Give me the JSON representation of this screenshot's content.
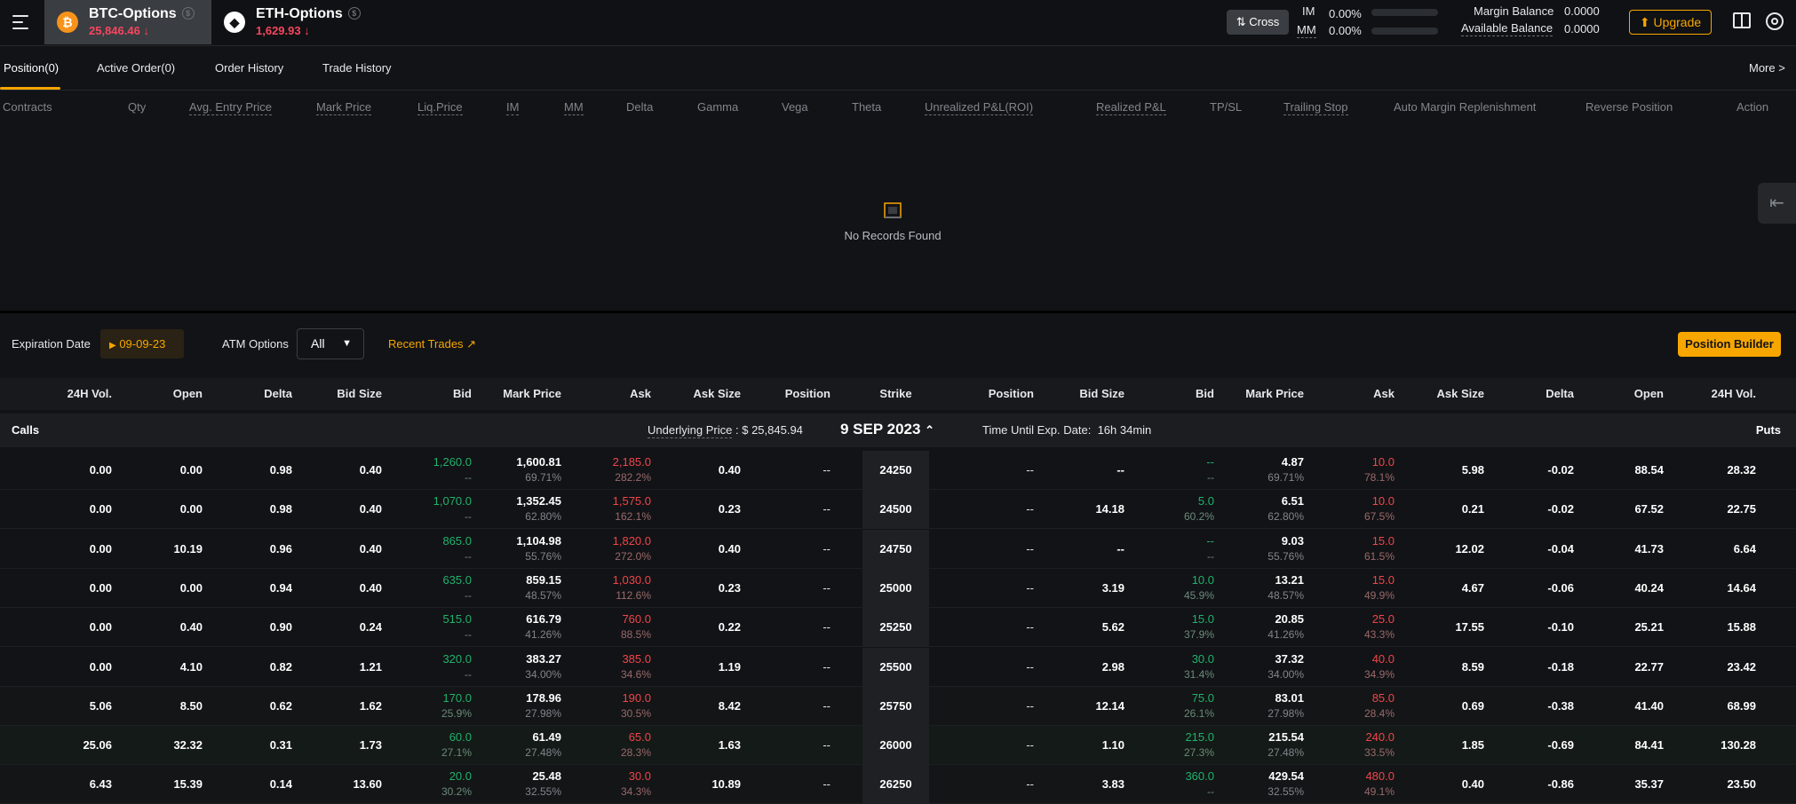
{
  "header": {
    "assets": [
      {
        "name": "BTC-Options",
        "price": "25,846.46",
        "arrow": "↓"
      },
      {
        "name": "ETH-Options",
        "price": "1,629.93",
        "arrow": "↓"
      }
    ],
    "cross_label": "Cross",
    "im_label": "IM",
    "im_value": "0.00%",
    "mm_label": "MM",
    "mm_value": "0.00%",
    "margin_balance_label": "Margin Balance",
    "margin_balance_value": "0.0000",
    "available_balance_label": "Available Balance",
    "available_balance_value": "0.0000",
    "upgrade_label": "Upgrade"
  },
  "tabs": [
    "Position(0)",
    "Active Order(0)",
    "Order History",
    "Trade History"
  ],
  "more_label": "More >",
  "position_columns": [
    "Contracts",
    "Qty",
    "Avg. Entry Price",
    "Mark Price",
    "Liq.Price",
    "IM",
    "MM",
    "Delta",
    "Gamma",
    "Vega",
    "Theta",
    "Unrealized P&L(ROI)",
    "Realized P&L",
    "TP/SL",
    "Trailing Stop",
    "Auto Margin Replenishment",
    "Reverse Position",
    "Action"
  ],
  "empty_text": "No Records Found",
  "filters": {
    "expiration_label": "Expiration Date",
    "expiration_value": "09-09-23",
    "atm_label": "ATM Options",
    "atm_value": "All",
    "recent_trades_label": "Recent Trades",
    "position_builder_label": "Position Builder"
  },
  "chain_columns": {
    "calls": [
      "24H Vol.",
      "Open",
      "Delta",
      "Bid Size",
      "Bid",
      "Mark Price",
      "Ask",
      "Ask Size",
      "Position"
    ],
    "strike": "Strike",
    "puts": [
      "Position",
      "Bid Size",
      "Bid",
      "Mark Price",
      "Ask",
      "Ask Size",
      "Delta",
      "Open",
      "24H Vol."
    ]
  },
  "chain_info": {
    "calls_label": "Calls",
    "puts_label": "Puts",
    "underlying_label": "Underlying Price",
    "underlying_value": ": $ 25,845.94",
    "expiry": "9 SEP 2023",
    "time_label": "Time Until Exp. Date:",
    "time_value": "16h 34min"
  },
  "rows": [
    {
      "strike": "24250",
      "call": {
        "vol": "0.00",
        "open": "0.00",
        "delta": "0.98",
        "bid_size": "0.40",
        "bid": "1,260.0",
        "bid_iv": "--",
        "mark": "1,600.81",
        "mark_iv": "69.71%",
        "ask": "2,185.0",
        "ask_iv": "282.2%",
        "ask_size": "0.40",
        "position": "--"
      },
      "put": {
        "position": "--",
        "bid_size": "--",
        "bid": "--",
        "bid_iv": "--",
        "mark": "4.87",
        "mark_iv": "69.71%",
        "ask": "10.0",
        "ask_iv": "78.1%",
        "ask_size": "5.98",
        "delta": "-0.02",
        "open": "88.54",
        "vol": "28.32"
      }
    },
    {
      "strike": "24500",
      "call": {
        "vol": "0.00",
        "open": "0.00",
        "delta": "0.98",
        "bid_size": "0.40",
        "bid": "1,070.0",
        "bid_iv": "--",
        "mark": "1,352.45",
        "mark_iv": "62.80%",
        "ask": "1,575.0",
        "ask_iv": "162.1%",
        "ask_size": "0.23",
        "position": "--"
      },
      "put": {
        "position": "--",
        "bid_size": "14.18",
        "bid": "5.0",
        "bid_iv": "60.2%",
        "mark": "6.51",
        "mark_iv": "62.80%",
        "ask": "10.0",
        "ask_iv": "67.5%",
        "ask_size": "0.21",
        "delta": "-0.02",
        "open": "67.52",
        "vol": "22.75"
      }
    },
    {
      "strike": "24750",
      "call": {
        "vol": "0.00",
        "open": "10.19",
        "delta": "0.96",
        "bid_size": "0.40",
        "bid": "865.0",
        "bid_iv": "--",
        "mark": "1,104.98",
        "mark_iv": "55.76%",
        "ask": "1,820.0",
        "ask_iv": "272.0%",
        "ask_size": "0.40",
        "position": "--"
      },
      "put": {
        "position": "--",
        "bid_size": "--",
        "bid": "--",
        "bid_iv": "--",
        "mark": "9.03",
        "mark_iv": "55.76%",
        "ask": "15.0",
        "ask_iv": "61.5%",
        "ask_size": "12.02",
        "delta": "-0.04",
        "open": "41.73",
        "vol": "6.64"
      }
    },
    {
      "strike": "25000",
      "call": {
        "vol": "0.00",
        "open": "0.00",
        "delta": "0.94",
        "bid_size": "0.40",
        "bid": "635.0",
        "bid_iv": "--",
        "mark": "859.15",
        "mark_iv": "48.57%",
        "ask": "1,030.0",
        "ask_iv": "112.6%",
        "ask_size": "0.23",
        "position": "--"
      },
      "put": {
        "position": "--",
        "bid_size": "3.19",
        "bid": "10.0",
        "bid_iv": "45.9%",
        "mark": "13.21",
        "mark_iv": "48.57%",
        "ask": "15.0",
        "ask_iv": "49.9%",
        "ask_size": "4.67",
        "delta": "-0.06",
        "open": "40.24",
        "vol": "14.64"
      }
    },
    {
      "strike": "25250",
      "call": {
        "vol": "0.00",
        "open": "0.40",
        "delta": "0.90",
        "bid_size": "0.24",
        "bid": "515.0",
        "bid_iv": "--",
        "mark": "616.79",
        "mark_iv": "41.26%",
        "ask": "760.0",
        "ask_iv": "88.5%",
        "ask_size": "0.22",
        "position": "--"
      },
      "put": {
        "position": "--",
        "bid_size": "5.62",
        "bid": "15.0",
        "bid_iv": "37.9%",
        "mark": "20.85",
        "mark_iv": "41.26%",
        "ask": "25.0",
        "ask_iv": "43.3%",
        "ask_size": "17.55",
        "delta": "-0.10",
        "open": "25.21",
        "vol": "15.88"
      }
    },
    {
      "strike": "25500",
      "call": {
        "vol": "0.00",
        "open": "4.10",
        "delta": "0.82",
        "bid_size": "1.21",
        "bid": "320.0",
        "bid_iv": "--",
        "mark": "383.27",
        "mark_iv": "34.00%",
        "ask": "385.0",
        "ask_iv": "34.6%",
        "ask_size": "1.19",
        "position": "--"
      },
      "put": {
        "position": "--",
        "bid_size": "2.98",
        "bid": "30.0",
        "bid_iv": "31.4%",
        "mark": "37.32",
        "mark_iv": "34.00%",
        "ask": "40.0",
        "ask_iv": "34.9%",
        "ask_size": "8.59",
        "delta": "-0.18",
        "open": "22.77",
        "vol": "23.42"
      }
    },
    {
      "strike": "25750",
      "call": {
        "vol": "5.06",
        "open": "8.50",
        "delta": "0.62",
        "bid_size": "1.62",
        "bid": "170.0",
        "bid_iv": "25.9%",
        "mark": "178.96",
        "mark_iv": "27.98%",
        "ask": "190.0",
        "ask_iv": "30.5%",
        "ask_size": "8.42",
        "position": "--"
      },
      "put": {
        "position": "--",
        "bid_size": "12.14",
        "bid": "75.0",
        "bid_iv": "26.1%",
        "mark": "83.01",
        "mark_iv": "27.98%",
        "ask": "85.0",
        "ask_iv": "28.4%",
        "ask_size": "0.69",
        "delta": "-0.38",
        "open": "41.40",
        "vol": "68.99"
      }
    },
    {
      "strike": "26000",
      "call": {
        "vol": "25.06",
        "open": "32.32",
        "delta": "0.31",
        "bid_size": "1.73",
        "bid": "60.0",
        "bid_iv": "27.1%",
        "mark": "61.49",
        "mark_iv": "27.48%",
        "ask": "65.0",
        "ask_iv": "28.3%",
        "ask_size": "1.63",
        "position": "--"
      },
      "put": {
        "position": "--",
        "bid_size": "1.10",
        "bid": "215.0",
        "bid_iv": "27.3%",
        "mark": "215.54",
        "mark_iv": "27.48%",
        "ask": "240.0",
        "ask_iv": "33.5%",
        "ask_size": "1.85",
        "delta": "-0.69",
        "open": "84.41",
        "vol": "130.28"
      }
    },
    {
      "strike": "26250",
      "call": {
        "vol": "6.43",
        "open": "15.39",
        "delta": "0.14",
        "bid_size": "13.60",
        "bid": "20.0",
        "bid_iv": "30.2%",
        "mark": "25.48",
        "mark_iv": "32.55%",
        "ask": "30.0",
        "ask_iv": "34.3%",
        "ask_size": "10.89",
        "position": "--"
      },
      "put": {
        "position": "--",
        "bid_size": "3.83",
        "bid": "360.0",
        "bid_iv": "--",
        "mark": "429.54",
        "mark_iv": "32.55%",
        "ask": "480.0",
        "ask_iv": "49.1%",
        "ask_size": "0.40",
        "delta": "-0.86",
        "open": "35.37",
        "vol": "23.50"
      }
    }
  ],
  "colors": {
    "accent": "#f7a600",
    "up": "#20b26c",
    "down": "#ef454a",
    "bg": "#121316"
  }
}
